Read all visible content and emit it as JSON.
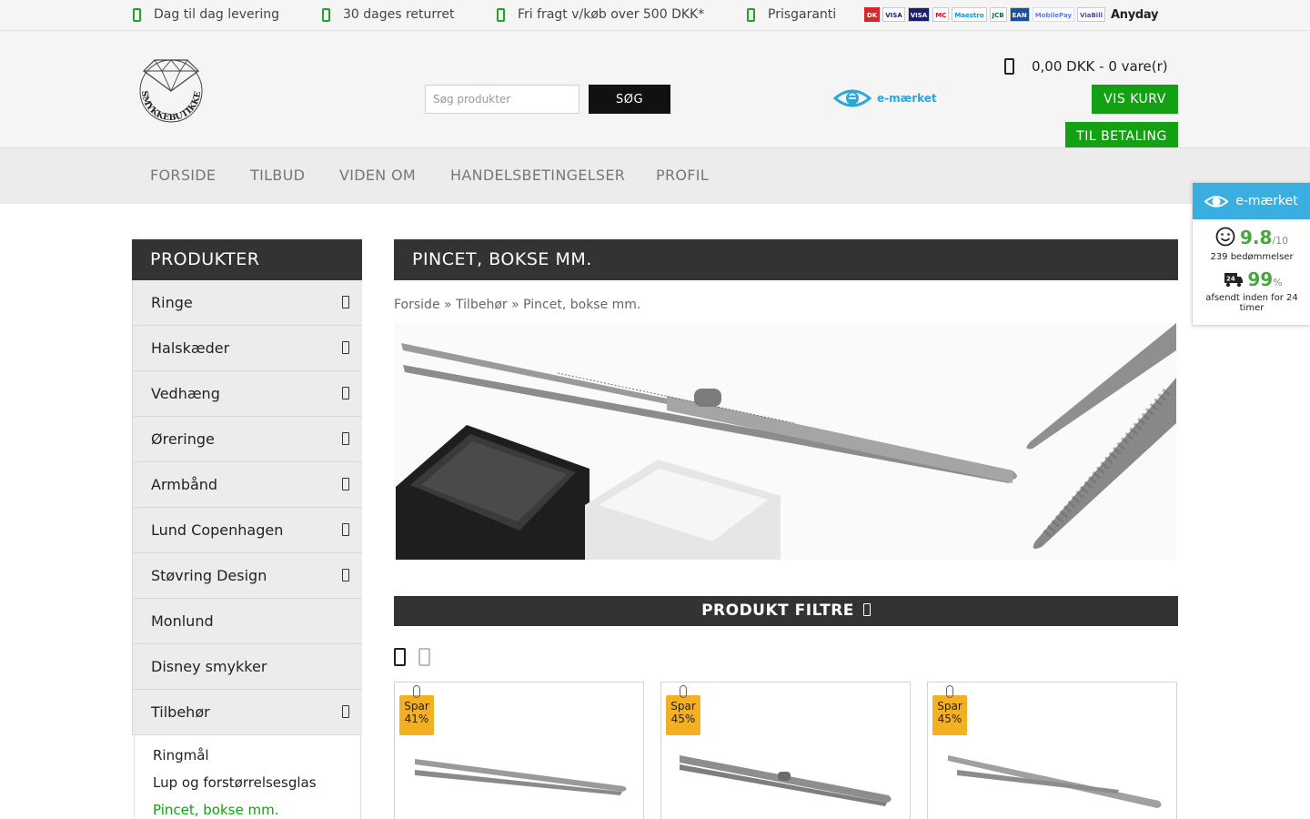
{
  "topbar": {
    "usps": [
      "Dag til dag levering",
      "30 dages returret",
      "Fri fragt v/køb over 500 DKK*",
      "Prisgaranti"
    ],
    "payments": [
      "DK",
      "VISA",
      "VISA",
      "MC",
      "Maestro",
      "JCB",
      "EAN",
      "MobilePay",
      "ViaBill"
    ],
    "anyday": "Anyday"
  },
  "header": {
    "logo_text": "SMYKKEBUTIKKEN.COM",
    "search_placeholder": "Søg produkter",
    "search_button": "SØG",
    "emaerket": "e-mærket",
    "cart_summary": "0,00 DKK - 0 vare(r)",
    "vis_kurv": "VIS KURV",
    "til_betaling": "TIL BETALING"
  },
  "nav": [
    "FORSIDE",
    "TILBUD",
    "VIDEN OM",
    "HANDELSBETINGELSER",
    "PROFIL"
  ],
  "sidebar": {
    "title": "PRODUKTER",
    "items": [
      "Ringe",
      "Halskæder",
      "Vedhæng",
      "Øreringe",
      "Armbånd",
      "Lund Copenhagen",
      "Støvring Design",
      "Monlund",
      "Disney smykker",
      "Tilbehør"
    ],
    "subitems": [
      "Ringmål",
      "Lup og forstørrelsesglas",
      "Pincet, bokse mm."
    ]
  },
  "main": {
    "title": "PINCET, BOKSE MM.",
    "breadcrumb": [
      "Forside",
      "Tilbehør",
      "Pincet, bokse mm."
    ],
    "breadcrumb_sep": "»",
    "filter_label": "PRODUKT FILTRE"
  },
  "products": [
    {
      "badge_spar": "Spar",
      "badge_pct": "41%"
    },
    {
      "badge_spar": "Spar",
      "badge_pct": "45%"
    },
    {
      "badge_spar": "Spar",
      "badge_pct": "45%"
    }
  ],
  "widget": {
    "title": "e-mærket",
    "rating": "9.8",
    "rating_max": "/10",
    "reviews": "239 bedømmelser",
    "shipping_pct": "99",
    "pct_sign": "%",
    "shipping_label": "afsendt inden for 24 timer",
    "truck_num": "24"
  },
  "colors": {
    "accent_green": "#13a113",
    "dark": "#333333",
    "badge": "#f2b022",
    "emaerket_blue": "#3aaee0"
  },
  "icons": [
    "truck-icon",
    "return-icon",
    "shipping-icon",
    "price-icon",
    "cart-icon",
    "chevron-down-icon",
    "grid-view-icon",
    "list-view-icon",
    "eye-icon",
    "smiley-icon"
  ]
}
